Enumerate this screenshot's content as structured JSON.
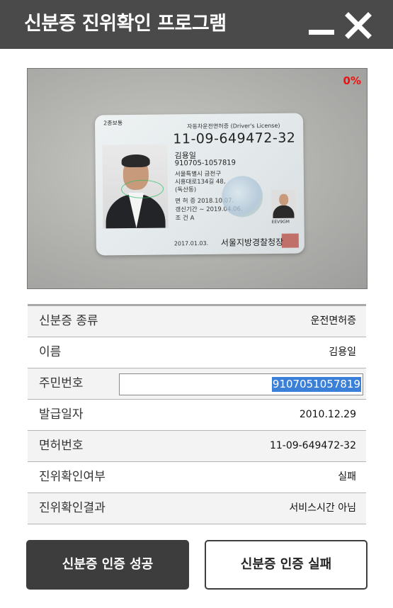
{
  "window": {
    "title": "신분증 진위확인 프로그램",
    "minimize_icon": "minimize-icon",
    "close_icon": "close-icon"
  },
  "camera": {
    "progress_text": "0%",
    "progress_color": "#ee1111",
    "card": {
      "type_text": "2종보통",
      "title_text": "자동차운전면허증 (Driver's License)",
      "license_number": "11-09-649472-32",
      "name": "김용일",
      "rrn": "910705-1057819",
      "address_1": "서울특별시 금천구",
      "address_2": "시흥대로134길 48,",
      "address_3": "(독산동)",
      "test_date": "면 허 증  2018.10.07.",
      "renewal": "갱신기간  ~ 2019.04.06.",
      "conditions": "조    건  A",
      "code": "EEV9GM",
      "issue_date": "2017.01.03.",
      "issuer": "서울지방경찰청장"
    }
  },
  "info_table": {
    "rows": [
      {
        "label": "신분증 종류",
        "value": "운전면허증"
      },
      {
        "label": "이름",
        "value": "김용일"
      },
      {
        "label": "주민번호",
        "value": "9107051057819"
      },
      {
        "label": "발급일자",
        "value": "2010.12.29"
      },
      {
        "label": "면허번호",
        "value": "11-09-649472-32"
      },
      {
        "label": "진위확인여부",
        "value": "실패"
      },
      {
        "label": "진위확인결과",
        "value": "서비스시간 아님"
      }
    ]
  },
  "buttons": {
    "success_label": "신분증 인증 성공",
    "fail_label": "신분증 인증 실패"
  },
  "colors": {
    "titlebar": "#4a4a4a",
    "selection": "#3a7fd8",
    "primary_button": "#3d3d3d"
  }
}
